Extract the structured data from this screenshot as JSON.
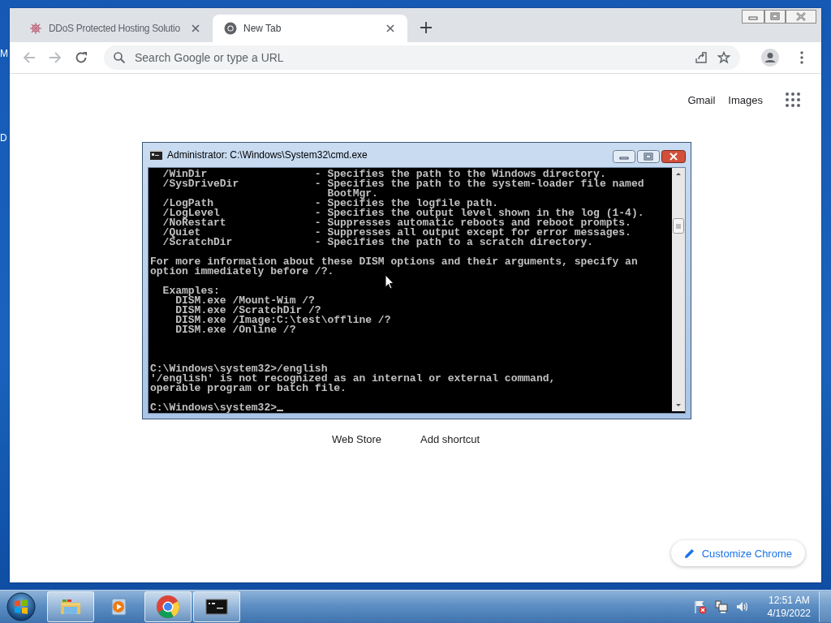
{
  "desktop": {
    "edge_labels": [
      "M",
      "D"
    ]
  },
  "browser": {
    "tabs": [
      {
        "title": "DDoS Protected Hosting Solutio",
        "kind": "site",
        "selected": false
      },
      {
        "title": "New Tab",
        "kind": "chrome",
        "selected": true
      }
    ],
    "nav": [
      {
        "kind": "back",
        "disabled": true
      },
      {
        "kind": "forward",
        "disabled": true
      },
      {
        "kind": "reload",
        "disabled": false
      }
    ],
    "omnibox": {
      "placeholder": "Search Google or type a URL"
    },
    "header_links": [
      "Gmail",
      "Images"
    ],
    "shortcuts": [
      "Web Store",
      "Add shortcut"
    ],
    "customize_button": "Customize Chrome"
  },
  "console": {
    "title": "Administrator: C:\\Windows\\System32\\cmd.exe",
    "lines": [
      {
        "kind": "text",
        "text": "  /WinDir                 - Specifies the path to the Windows directory."
      },
      {
        "kind": "text",
        "text": "  /SysDriveDir            - Specifies the path to the system-loader file named"
      },
      {
        "kind": "text",
        "text": "                            BootMgr."
      },
      {
        "kind": "text",
        "text": "  /LogPath                - Specifies the logfile path."
      },
      {
        "kind": "text",
        "text": "  /LogLevel               - Specifies the output level shown in the log (1-4)."
      },
      {
        "kind": "text",
        "text": "  /NoRestart              - Suppresses automatic reboots and reboot prompts."
      },
      {
        "kind": "text",
        "text": "  /Quiet                  - Suppresses all output except for error messages."
      },
      {
        "kind": "text",
        "text": "  /ScratchDir             - Specifies the path to a scratch directory."
      },
      {
        "kind": "blank"
      },
      {
        "kind": "text",
        "text": "For more information about these DISM options and their arguments, specify an"
      },
      {
        "kind": "text",
        "text": "option immediately before /?."
      },
      {
        "kind": "blank"
      },
      {
        "kind": "text",
        "text": "  Examples:"
      },
      {
        "kind": "text",
        "text": "    DISM.exe /Mount-Wim /?"
      },
      {
        "kind": "text",
        "text": "    DISM.exe /ScratchDir /?"
      },
      {
        "kind": "text",
        "text": "    DISM.exe /Image:C:\\test\\offline /?"
      },
      {
        "kind": "text",
        "text": "    DISM.exe /Online /?"
      },
      {
        "kind": "blank"
      },
      {
        "kind": "blank"
      },
      {
        "kind": "blank"
      },
      {
        "kind": "text",
        "text": "C:\\Windows\\system32>/english"
      },
      {
        "kind": "text",
        "text": "'/english' is not recognized as an internal or external command,"
      },
      {
        "kind": "text",
        "text": "operable program or batch file."
      },
      {
        "kind": "blank"
      },
      {
        "kind": "prompt",
        "text": "C:\\Windows\\system32>"
      }
    ]
  },
  "taskbar": {
    "apps": [
      {
        "kind": "explorer",
        "running": true
      },
      {
        "kind": "media",
        "running": false
      },
      {
        "kind": "chrome",
        "running": true
      },
      {
        "kind": "cmd",
        "running": true
      }
    ],
    "clock": {
      "time": "12:51 AM",
      "date": "4/19/2022"
    }
  }
}
